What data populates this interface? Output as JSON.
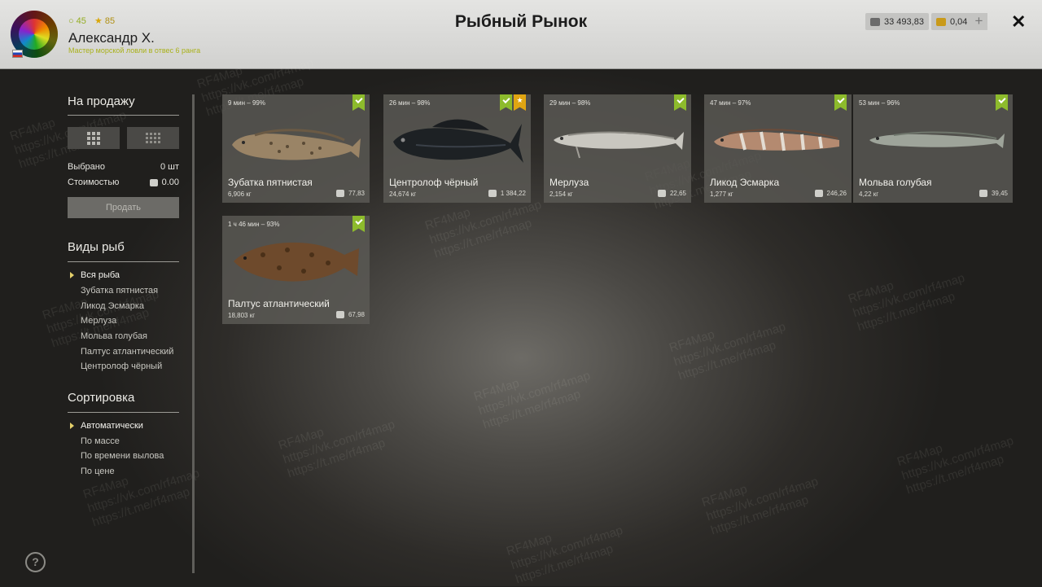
{
  "header": {
    "title": "Рыбный Рынок",
    "player_level": "45",
    "player_rating": "85",
    "player_name": "Александр Х.",
    "player_rank": "Мастер морской ловли в отвес 6 ранга",
    "silver": "33 493,83",
    "gold": "0,04",
    "plus": "+",
    "close": "✕"
  },
  "sidebar": {
    "sale_heading": "На продажу",
    "selected_label": "Выбрано",
    "selected_value": "0 шт",
    "cost_label": "Стоимостью",
    "cost_value": "0.00",
    "sell_button": "Продать",
    "species_heading": "Виды рыб",
    "species": [
      "Вся рыба",
      "Зубатка пятнистая",
      "Ликод Эсмарка",
      "Мерлуза",
      "Мольва голубая",
      "Палтус атлантический",
      "Центролоф чёрный"
    ],
    "sort_heading": "Сортировка",
    "sort": [
      "Автоматически",
      "По массе",
      "По времени вылова",
      "По цене"
    ],
    "help": "?"
  },
  "cards": [
    {
      "time": "9 мин – 99%",
      "name": "Зубатка пятнистая",
      "mass": "6,906 кг",
      "price": "77,83",
      "icon": "spotted-wolffish"
    },
    {
      "time": "26 мин – 98%",
      "name": "Центролоф чёрный",
      "mass": "24,674 кг",
      "price": "1 384,22",
      "icon": "black-centrolophus",
      "starred": true
    },
    {
      "time": "29 мин – 98%",
      "name": "Мерлуза",
      "mass": "2,154 кг",
      "price": "22,65",
      "icon": "hake"
    },
    {
      "time": "47 мин – 97%",
      "name": "Ликод Эсмарка",
      "mass": "1,277 кг",
      "price": "246,26",
      "icon": "esmark-eelpout"
    },
    {
      "time": "53 мин – 96%",
      "name": "Мольва голубая",
      "mass": "4,22 кг",
      "price": "39,45",
      "icon": "blue-ling"
    },
    {
      "time": "1 ч 46 мин – 93%",
      "name": "Палтус атлантический",
      "mass": "18,803 кг",
      "price": "67,98",
      "icon": "atlantic-halibut"
    }
  ],
  "watermark": {
    "line1": "RF4Map",
    "line2": "https://vk.com/rf4map",
    "line3": "https://t.me/rf4map"
  },
  "colors": {
    "check": "#8dbb2c",
    "star": "#e0a512",
    "accent_bullet": "#e4d06a"
  }
}
